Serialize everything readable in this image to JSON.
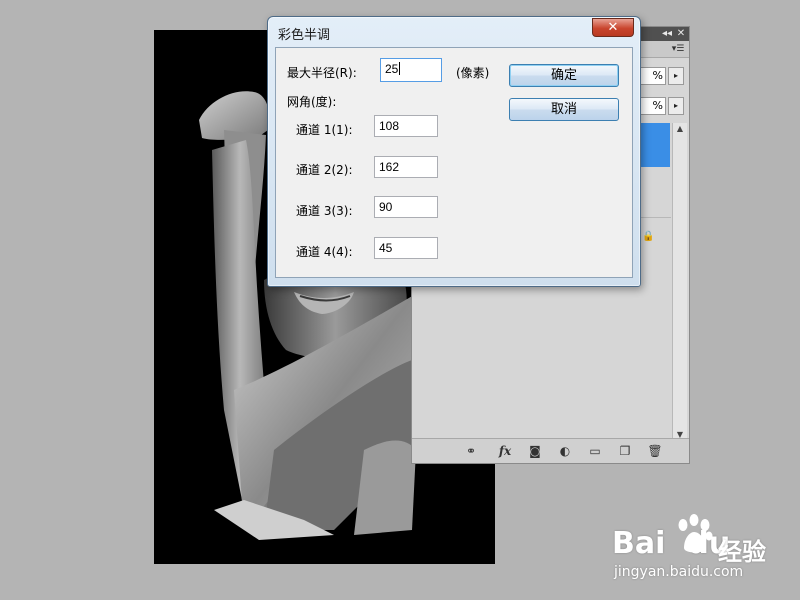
{
  "dialog": {
    "title": "彩色半调",
    "close_glyph": "✕",
    "max_radius_label": "最大半径(R):",
    "max_radius_value": "25",
    "unit_label": "(像素)",
    "screen_angles_label": "网角(度):",
    "channels": [
      {
        "label": "通道 1(1):",
        "value": "108"
      },
      {
        "label": "通道 2(2):",
        "value": "162"
      },
      {
        "label": "通道 3(3):",
        "value": "90"
      },
      {
        "label": "通道 4(4):",
        "value": "45"
      }
    ],
    "ok_label": "确定",
    "cancel_label": "取消"
  },
  "layers_panel": {
    "collapse_glyph": "◂◂",
    "close_glyph": "✕",
    "menu_glyph": "▾☰",
    "opacity_suffix": "%",
    "fill_suffix": "%",
    "stepper_glyph": "▸",
    "lock_glyph": "🔒",
    "footer_fx": "fx"
  },
  "watermark": {
    "logo": "Bai",
    "logo_tail": "du",
    "brand_cn": "经验",
    "url": "jingyan.baidu.com"
  },
  "colors": {
    "dialog_close": "#c9452e",
    "layer_selected": "#3a8ee6",
    "background": "#b4b4b4"
  }
}
